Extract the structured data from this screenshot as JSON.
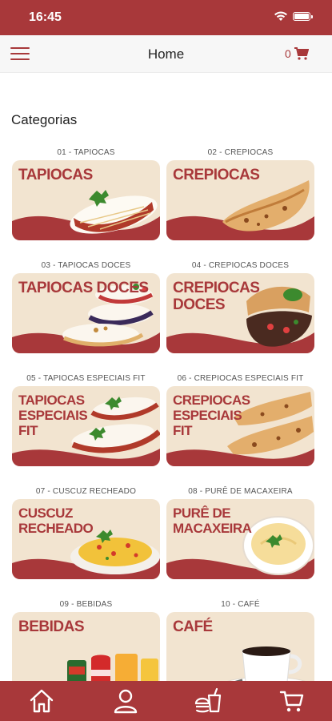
{
  "status": {
    "time": "16:45"
  },
  "header": {
    "title": "Home",
    "cart_count": "0"
  },
  "section": {
    "title": "Categorias"
  },
  "categories": [
    {
      "caption": "01 - TAPIOCAS",
      "label": "TAPIOCAS"
    },
    {
      "caption": "02 - CREPIOCAS",
      "label": "CREPIOCAS"
    },
    {
      "caption": "03 - TAPIOCAS DOCES",
      "label": "TAPIOCAS DOCES"
    },
    {
      "caption": "04 - CREPIOCAS DOCES",
      "label": "CREPIOCAS DOCES"
    },
    {
      "caption": "05 - TAPIOCAS ESPECIAIS FIT",
      "label": "TAPIOCAS ESPECIAIS FIT"
    },
    {
      "caption": "06 - CREPIOCAS ESPECIAIS FIT",
      "label": "CREPIOCAS ESPECIAIS FIT"
    },
    {
      "caption": "07 - CUSCUZ RECHEADO",
      "label": "CUSCUZ RECHEADO"
    },
    {
      "caption": "08 - PURÊ DE MACAXEIRA",
      "label": "PURÊ DE MACAXEIRA"
    },
    {
      "caption": "09 - BEBIDAS",
      "label": "BEBIDAS"
    },
    {
      "caption": "10 - CAFÉ",
      "label": "CAFÉ"
    }
  ],
  "colors": {
    "brand": "#a8383a",
    "card_bg": "#f2e4d0",
    "appbar_bg": "#f7f7f7"
  },
  "icons": {
    "menu": "hamburger-icon",
    "cart": "cart-icon",
    "home": "home-icon",
    "profile": "user-icon",
    "food": "food-icon"
  }
}
